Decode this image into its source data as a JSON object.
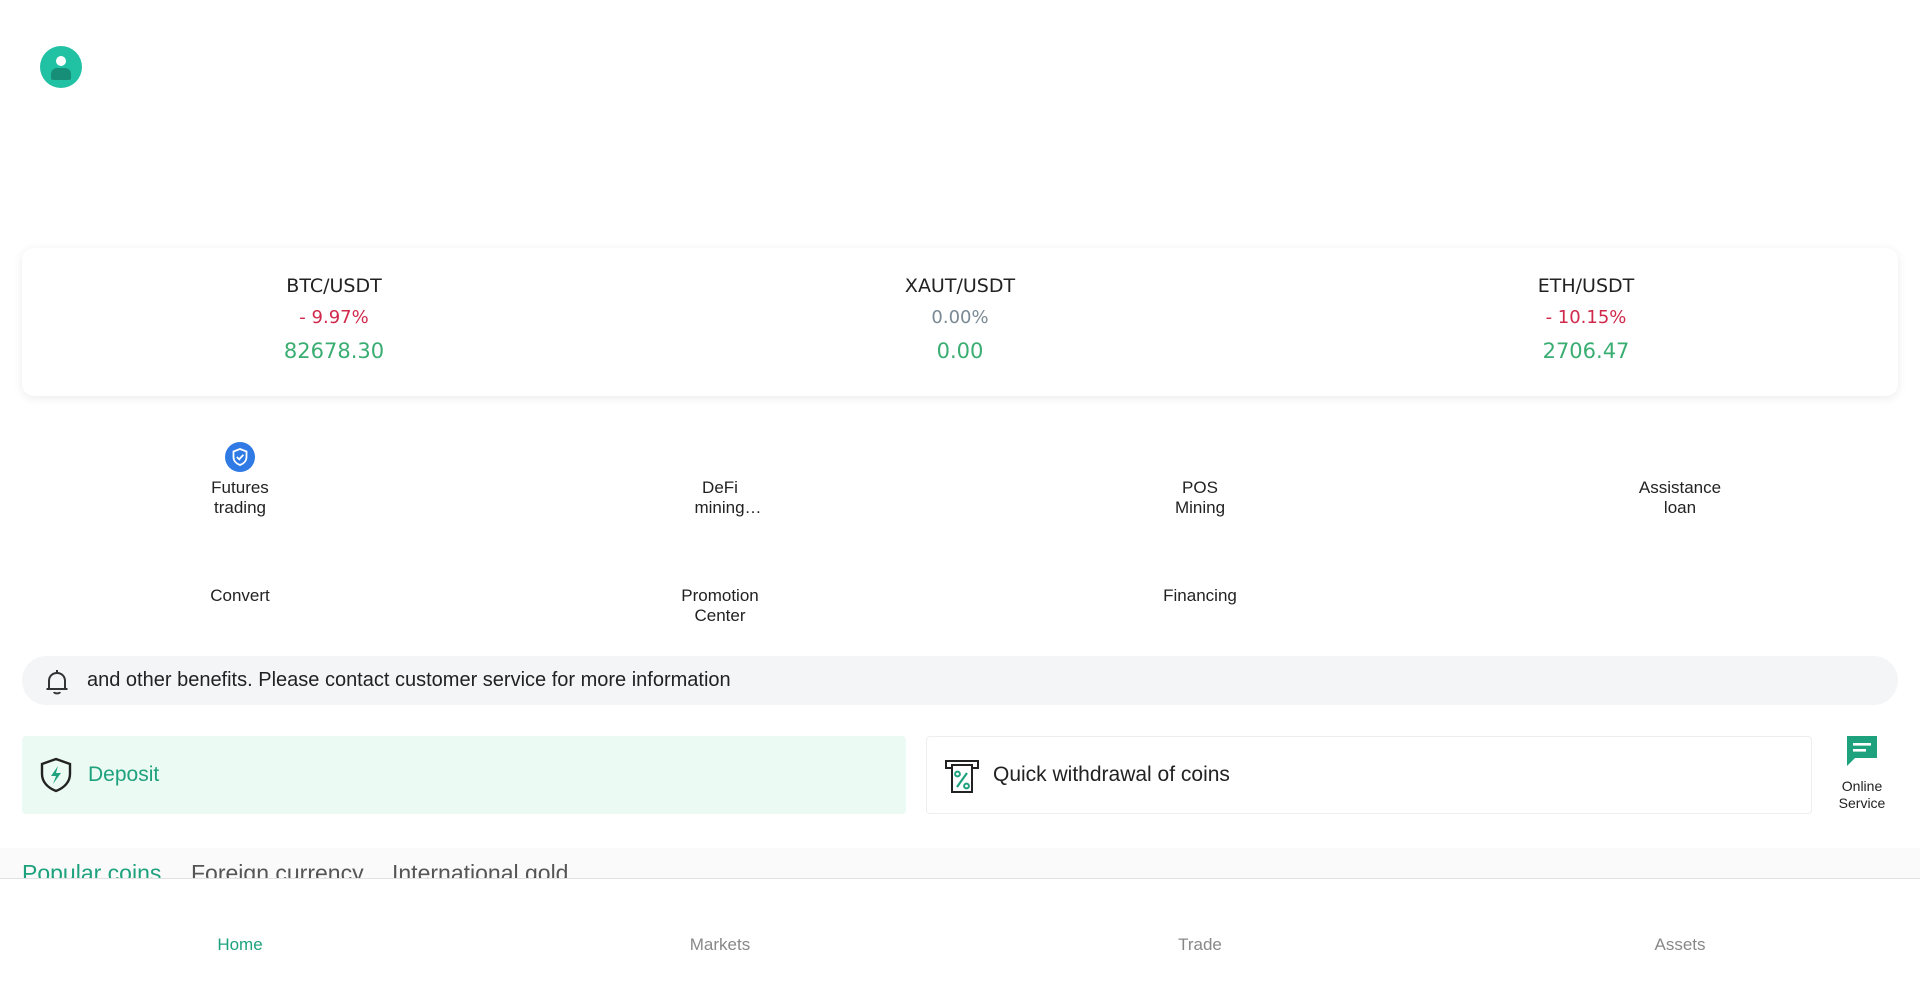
{
  "tickers": [
    {
      "pair": "BTC/USDT",
      "change": "- 9.97%",
      "price": "82678.30"
    },
    {
      "pair": "XAUT/USDT",
      "change": "0.00%",
      "price": "0.00"
    },
    {
      "pair": "ETH/USDT",
      "change": "- 10.15%",
      "price": "2706.47"
    }
  ],
  "menu": {
    "futures": {
      "line1": "Futures",
      "line2": "trading"
    },
    "defi": {
      "line1": "DeFi",
      "line2": "mining…"
    },
    "pos": {
      "line1": "POS",
      "line2": "Mining"
    },
    "loan": {
      "line1": "Assistance",
      "line2": "loan"
    },
    "convert": {
      "line1": "Convert"
    },
    "promotion": {
      "line1": "Promotion",
      "line2": "Center"
    },
    "financing": {
      "line1": "Financing"
    }
  },
  "notice": {
    "text": "and other benefits. Please contact customer service for more information"
  },
  "actions": {
    "deposit": "Deposit",
    "withdraw": "Quick withdrawal of coins",
    "online_line1": "Online",
    "online_line2": "Service"
  },
  "tabs": [
    "Popular coins",
    "Foreign currency",
    "International gold"
  ],
  "nav": [
    "Home",
    "Markets",
    "Trade",
    "Assets"
  ],
  "colors": {
    "accent": "#1ea27d",
    "up": "#3aae72",
    "down": "#d0294b",
    "flat": "#7a8a95",
    "avatar": "#21c2a4",
    "shield_badge": "#2f7ae5"
  }
}
